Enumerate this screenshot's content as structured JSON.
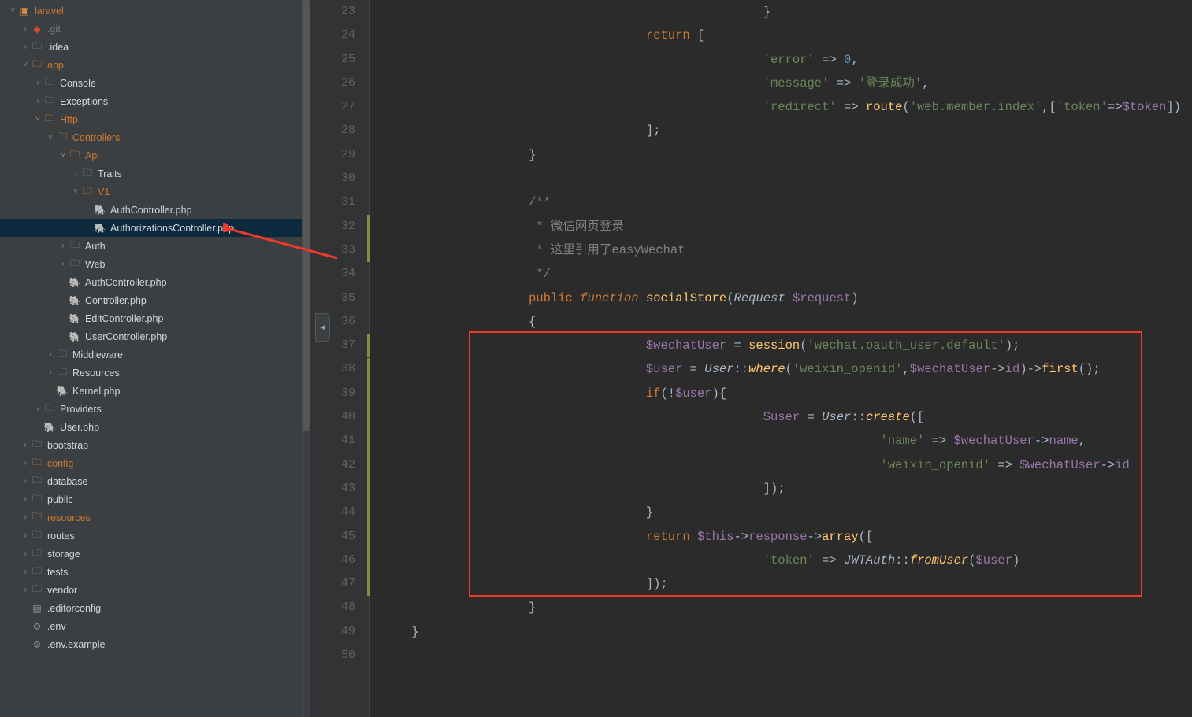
{
  "tree": [
    {
      "depth": 0,
      "arrow": "down",
      "icon": "project",
      "label": "laravel",
      "cls": "orange"
    },
    {
      "depth": 1,
      "arrow": "right",
      "icon": "git",
      "label": ".git",
      "cls": "grey"
    },
    {
      "depth": 1,
      "arrow": "right",
      "icon": "folder",
      "label": ".idea",
      "cls": "white"
    },
    {
      "depth": 1,
      "arrow": "down",
      "icon": "folder-o",
      "label": "app",
      "cls": "orange"
    },
    {
      "depth": 2,
      "arrow": "right",
      "icon": "folder",
      "label": "Console",
      "cls": "white"
    },
    {
      "depth": 2,
      "arrow": "right",
      "icon": "folder",
      "label": "Exceptions",
      "cls": "white"
    },
    {
      "depth": 2,
      "arrow": "down",
      "icon": "folder-o",
      "label": "Http",
      "cls": "orange"
    },
    {
      "depth": 3,
      "arrow": "down",
      "icon": "folder-o",
      "label": "Controllers",
      "cls": "orange"
    },
    {
      "depth": 4,
      "arrow": "down",
      "icon": "folder-o",
      "label": "Api",
      "cls": "orange"
    },
    {
      "depth": 5,
      "arrow": "right",
      "icon": "folder",
      "label": "Traits",
      "cls": "white"
    },
    {
      "depth": 5,
      "arrow": "down",
      "icon": "folder-o",
      "label": "V1",
      "cls": "orange"
    },
    {
      "depth": 6,
      "arrow": "",
      "icon": "php",
      "label": "AuthController.php",
      "cls": "white"
    },
    {
      "depth": 6,
      "arrow": "",
      "icon": "php",
      "label": "AuthorizationsController.php",
      "cls": "white",
      "selected": true
    },
    {
      "depth": 4,
      "arrow": "right",
      "icon": "folder",
      "label": "Auth",
      "cls": "white"
    },
    {
      "depth": 4,
      "arrow": "right",
      "icon": "folder",
      "label": "Web",
      "cls": "white"
    },
    {
      "depth": 4,
      "arrow": "",
      "icon": "php",
      "label": "AuthController.php",
      "cls": "white"
    },
    {
      "depth": 4,
      "arrow": "",
      "icon": "php",
      "label": "Controller.php",
      "cls": "white"
    },
    {
      "depth": 4,
      "arrow": "",
      "icon": "php",
      "label": "EditController.php",
      "cls": "white"
    },
    {
      "depth": 4,
      "arrow": "",
      "icon": "php",
      "label": "UserController.php",
      "cls": "white"
    },
    {
      "depth": 3,
      "arrow": "right",
      "icon": "folder",
      "label": "Middleware",
      "cls": "white"
    },
    {
      "depth": 3,
      "arrow": "right",
      "icon": "folder",
      "label": "Resources",
      "cls": "white"
    },
    {
      "depth": 3,
      "arrow": "",
      "icon": "php",
      "label": "Kernel.php",
      "cls": "white"
    },
    {
      "depth": 2,
      "arrow": "right",
      "icon": "folder",
      "label": "Providers",
      "cls": "white"
    },
    {
      "depth": 2,
      "arrow": "",
      "icon": "php",
      "label": "User.php",
      "cls": "white"
    },
    {
      "depth": 1,
      "arrow": "right",
      "icon": "folder",
      "label": "bootstrap",
      "cls": "white"
    },
    {
      "depth": 1,
      "arrow": "right",
      "icon": "folder-o",
      "label": "config",
      "cls": "orange"
    },
    {
      "depth": 1,
      "arrow": "right",
      "icon": "folder",
      "label": "database",
      "cls": "white"
    },
    {
      "depth": 1,
      "arrow": "right",
      "icon": "folder",
      "label": "public",
      "cls": "white"
    },
    {
      "depth": 1,
      "arrow": "right",
      "icon": "folder-o",
      "label": "resources",
      "cls": "orange"
    },
    {
      "depth": 1,
      "arrow": "right",
      "icon": "folder",
      "label": "routes",
      "cls": "white"
    },
    {
      "depth": 1,
      "arrow": "right",
      "icon": "folder",
      "label": "storage",
      "cls": "white"
    },
    {
      "depth": 1,
      "arrow": "right",
      "icon": "folder",
      "label": "tests",
      "cls": "white"
    },
    {
      "depth": 1,
      "arrow": "right",
      "icon": "folder",
      "label": "vendor",
      "cls": "white"
    },
    {
      "depth": 1,
      "arrow": "",
      "icon": "cfg",
      "label": ".editorconfig",
      "cls": "white"
    },
    {
      "depth": 1,
      "arrow": "",
      "icon": "gear",
      "label": ".env",
      "cls": "white"
    },
    {
      "depth": 1,
      "arrow": "",
      "icon": "gear",
      "label": ".env.example",
      "cls": "white"
    }
  ],
  "gutter": {
    "start": 23,
    "end": 50
  },
  "modified_lines": [
    32,
    33,
    37,
    38,
    39,
    40,
    41,
    42,
    43,
    44,
    45,
    46,
    47
  ],
  "code": {
    "l23": {
      "indent": 13,
      "t": "}"
    },
    "l24": {
      "indent": 9,
      "kw": "return",
      "t": " ["
    },
    "l25": {
      "indent": 13,
      "s": "'error'",
      "op": " => ",
      "n": "0",
      "t": ","
    },
    "l26": {
      "indent": 13,
      "s": "'message'",
      "op": " => ",
      "s2": "'登录成功'",
      "t": ","
    },
    "l27": {
      "indent": 13,
      "s": "'redirect'",
      "op": " => ",
      "fn": "route",
      "t1": "(",
      "s2": "'web.member.index'",
      "t2": ",[",
      "s3": "'token'",
      "op2": "=>",
      "v": "$token",
      "t3": "])"
    },
    "l28": {
      "indent": 9,
      "t": "];"
    },
    "l29": {
      "indent": 5,
      "t": "}"
    },
    "l31": {
      "indent": 5,
      "c": "/**"
    },
    "l32": {
      "indent": 5,
      "c": " * 微信网页登录"
    },
    "l33": {
      "indent": 5,
      "c": " * 这里引用了easyWechat"
    },
    "l34": {
      "indent": 5,
      "c": " */"
    },
    "l35": {
      "indent": 5,
      "kw1": "public",
      "kw2": "function",
      "fn": "socialStore",
      "t1": "(",
      "cls": "Request",
      "v": "$request",
      "t2": ")"
    },
    "l36": {
      "indent": 5,
      "t": "{"
    },
    "l37": {
      "indent": 9,
      "v": "$wechatUser",
      "op": " = ",
      "fn": "session",
      "t1": "(",
      "s": "'wechat.oauth_user.default'",
      "t2": ");"
    },
    "l38": {
      "indent": 9,
      "v": "$user",
      "op": " = ",
      "cls": "User",
      "t1": "::",
      "sfn": "where",
      "t2": "(",
      "s": "'weixin_openid'",
      "t3": ",",
      "v2": "$wechatUser",
      "arr": "->",
      "p": "id",
      "t4": ")->",
      "fn": "first",
      "t5": "();"
    },
    "l39": {
      "indent": 9,
      "kw": "if",
      "t1": "(!",
      "v": "$user",
      "t2": "){"
    },
    "l40": {
      "indent": 13,
      "v": "$user",
      "op": " = ",
      "cls": "User",
      "t1": "::",
      "sfn": "create",
      "t2": "(["
    },
    "l41": {
      "indent": 17,
      "s": "'name'",
      "op": " => ",
      "v": "$wechatUser",
      "arr": "->",
      "p": "name",
      "t": ","
    },
    "l42": {
      "indent": 17,
      "s": "'weixin_openid'",
      "op": " => ",
      "v": "$wechatUser",
      "arr": "->",
      "p": "id"
    },
    "l43": {
      "indent": 13,
      "t": "]);"
    },
    "l44": {
      "indent": 9,
      "t": "}"
    },
    "l45": {
      "indent": 9,
      "kw": "return",
      "v": " $this",
      "arr": "->",
      "p": "response",
      "arr2": "->",
      "fn": "array",
      "t": "(["
    },
    "l46": {
      "indent": 13,
      "s": "'token'",
      "op": " => ",
      "cls": "JWTAuth",
      "t1": "::",
      "sfn": "fromUser",
      "t2": "(",
      "v": "$user",
      "t3": ")"
    },
    "l47": {
      "indent": 9,
      "t": "]);"
    },
    "l48": {
      "indent": 5,
      "t": "}"
    },
    "l49": {
      "indent": 1,
      "t": "}"
    }
  }
}
